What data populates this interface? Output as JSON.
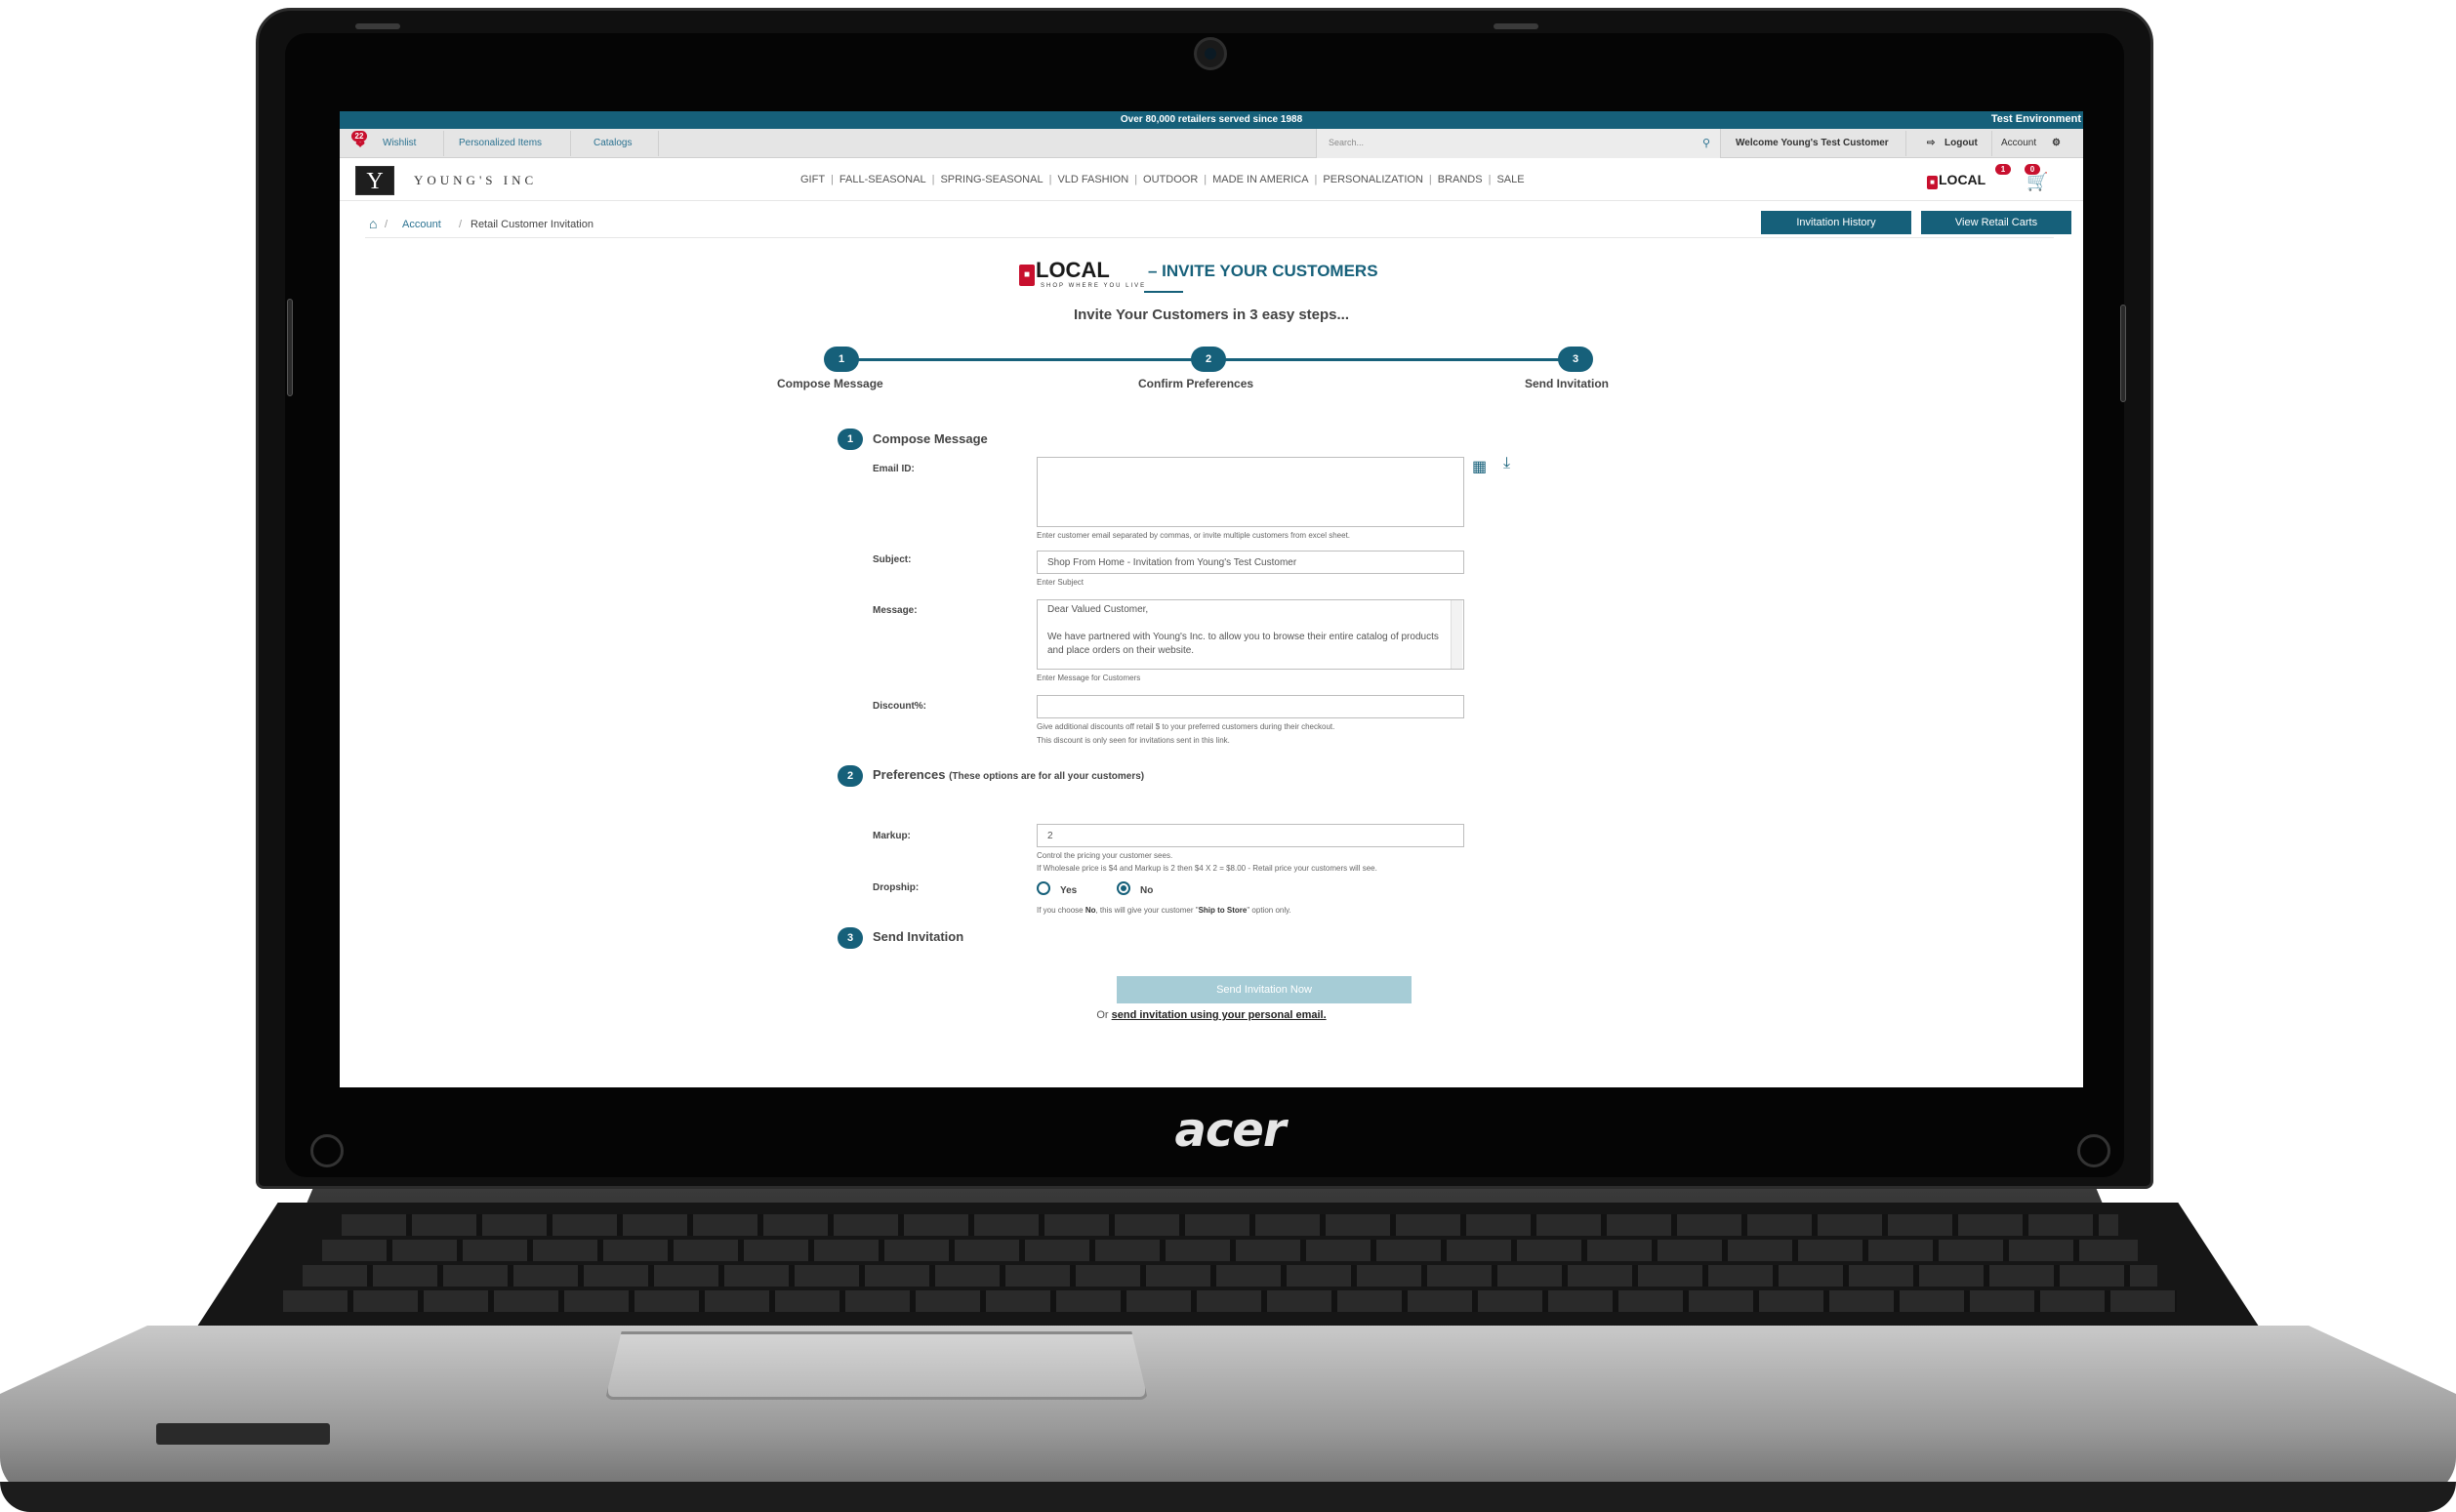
{
  "announcement": {
    "center_text": "Over 80,000 retailers served since 1988",
    "environment": "Test Environment"
  },
  "utility_bar": {
    "wishlist_count": "22",
    "wishlist_label": "Wishlist",
    "personalized_label": "Personalized Items",
    "catalogs_label": "Catalogs",
    "search_placeholder": "Search...",
    "welcome_text": "Welcome Young's Test Customer",
    "logout_label": "Logout",
    "account_label": "Account"
  },
  "brand": {
    "logo_letter": "Y",
    "name": "YOUNG'S INC"
  },
  "main_nav": [
    "GIFT",
    "FALL-SEASONAL",
    "SPRING-SEASONAL",
    "VLD FASHION",
    "OUTDOOR",
    "MADE IN AMERICA",
    "PERSONALIZATION",
    "BRANDS",
    "SALE"
  ],
  "local_logo": {
    "text": "LOCAL",
    "tagline": "SHOP WHERE YOU LIVE",
    "badge": "1"
  },
  "cart_badge": "0",
  "breadcrumb": {
    "account": "Account",
    "current": "Retail Customer Invitation"
  },
  "buttons": {
    "invitation_history": "Invitation History",
    "view_retail_carts": "View Retail Carts",
    "send_now": "Send Invitation Now"
  },
  "headline": {
    "title": "– INVITE YOUR CUSTOMERS",
    "subtitle": "Invite Your Customers in 3 easy steps..."
  },
  "steps": [
    {
      "num": "1",
      "label": "Compose Message"
    },
    {
      "num": "2",
      "label": "Confirm Preferences"
    },
    {
      "num": "3",
      "label": "Send Invitation"
    }
  ],
  "compose": {
    "num": "1",
    "title": "Compose Message",
    "email_label": "Email ID:",
    "email_value": "",
    "email_help": "Enter customer email separated by commas, or invite multiple customers from excel sheet.",
    "subject_label": "Subject:",
    "subject_value": "Shop From Home - Invitation from Young's Test Customer",
    "subject_help": "Enter Subject",
    "message_label": "Message:",
    "message_value": "Dear Valued Customer,\n\nWe have partnered with Young's Inc. to allow you to browse their entire catalog of products and place orders on their website.",
    "message_help": "Enter Message for Customers",
    "discount_label": "Discount%:",
    "discount_value": "",
    "discount_help_1": "Give additional discounts off retail $ to your preferred customers during their checkout.",
    "discount_help_2": "This discount is only seen for invitations sent in this link."
  },
  "preferences": {
    "num": "2",
    "title": "Preferences",
    "note": "(These options are for all your customers)",
    "markup_label": "Markup:",
    "markup_value": "2",
    "markup_help_1": "Control the pricing your customer sees.",
    "markup_help_2": "If Wholesale price is $4 and Markup is 2 then $4 X 2 = $8.00 - Retail price your customers will see.",
    "dropship_label": "Dropship:",
    "yes_label": "Yes",
    "no_label": "No",
    "dropship_help_pre": "If you choose ",
    "dropship_help_no": "No",
    "dropship_help_mid": ", this will give your customer \"",
    "dropship_help_bold": "Ship to Store",
    "dropship_help_post": "\" option only."
  },
  "send": {
    "num": "3",
    "title": "Send Invitation",
    "alt_prefix": "Or ",
    "alt_link": "send invitation using your personal email."
  },
  "device": {
    "brand": "acer"
  },
  "colors": {
    "primary": "#16607a",
    "accent_red": "#c8102e",
    "disabled_button": "#a6ccd6"
  }
}
